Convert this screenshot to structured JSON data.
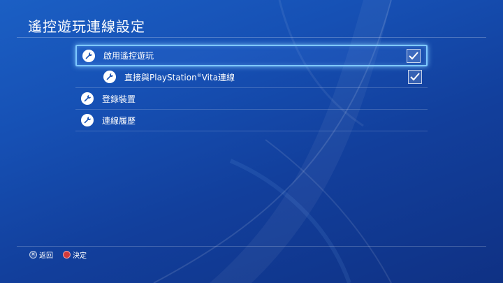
{
  "screen": {
    "title": "遙控遊玩連線設定"
  },
  "menu": {
    "items": [
      {
        "label": "啟用遙控遊玩",
        "icon": "wrench-icon",
        "checked": true,
        "selected": true
      },
      {
        "label_main": "直接與PlayStation",
        "label_sup": "®",
        "label_tail": "Vita連線",
        "icon": "wrench-icon",
        "checked": true,
        "selected": false
      },
      {
        "label": "登錄裝置",
        "icon": "wrench-icon"
      },
      {
        "label": "連線履歷",
        "icon": "wrench-icon"
      }
    ]
  },
  "footer": {
    "back_label": "返回",
    "confirm_label": "決定"
  },
  "colors": {
    "accent_highlight": "#7ec8ff",
    "background": "#1650b4",
    "circle_button": "#d23a3a"
  }
}
